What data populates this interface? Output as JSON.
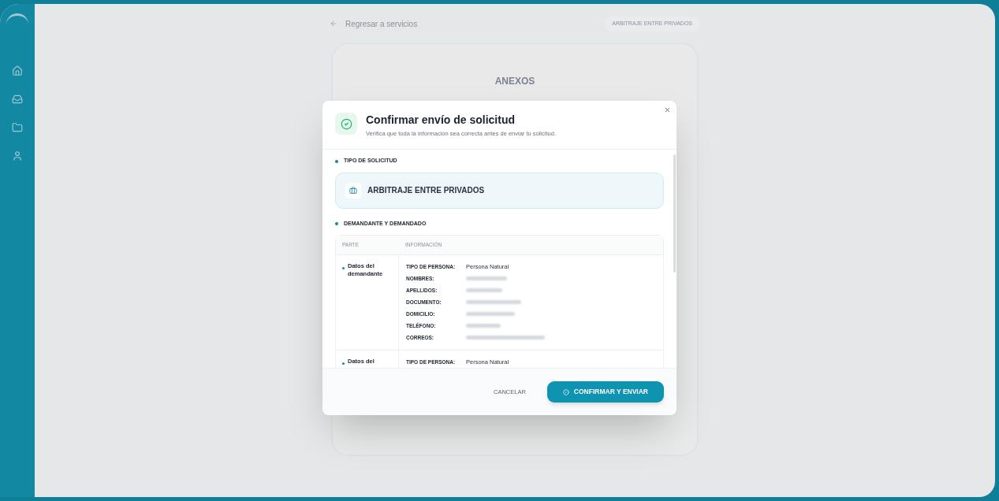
{
  "background": {
    "back_link": "Regresar a servicios",
    "breadcrumb_tag": "ARBITRAJE ENTRE PRIVADOS",
    "card_title": "ANEXOS"
  },
  "dialog": {
    "title": "Confirmar envío de solicitud",
    "subtitle": "Verifica que toda la información sea correcta antes de enviar tu solicitud.",
    "sections": [
      {
        "kind": "type",
        "label": "TIPO DE SOLICITUD",
        "value": "ARBITRAJE ENTRE PRIVADOS"
      },
      {
        "kind": "table",
        "label": "DEMANDANTE Y DEMANDADO",
        "columns": [
          "PARTE",
          "INFORMACIÓN"
        ],
        "rows": [
          {
            "party": "Datos del demandante",
            "fields": [
              {
                "label": "TIPO DE PERSONA:",
                "value": "Persona Natural"
              },
              {
                "label": "NOMBRES:",
                "redacted": true
              },
              {
                "label": "APELLIDOS:",
                "redacted": true
              },
              {
                "label": "DOCUMENTO:",
                "redacted": true
              },
              {
                "label": "DOMICILIO:",
                "redacted": true
              },
              {
                "label": "TELÉFONO:",
                "redacted": true
              },
              {
                "label": "CORREOS:",
                "redacted": true
              }
            ]
          },
          {
            "party": "Datos del",
            "fields": [
              {
                "label": "TIPO DE PERSONA:",
                "value": "Persona Natural"
              }
            ]
          }
        ]
      }
    ],
    "buttons": [
      {
        "kind": "secondary",
        "label": "CANCELAR"
      },
      {
        "kind": "primary",
        "label": "CONFIRMAR Y ENVIAR"
      }
    ]
  }
}
